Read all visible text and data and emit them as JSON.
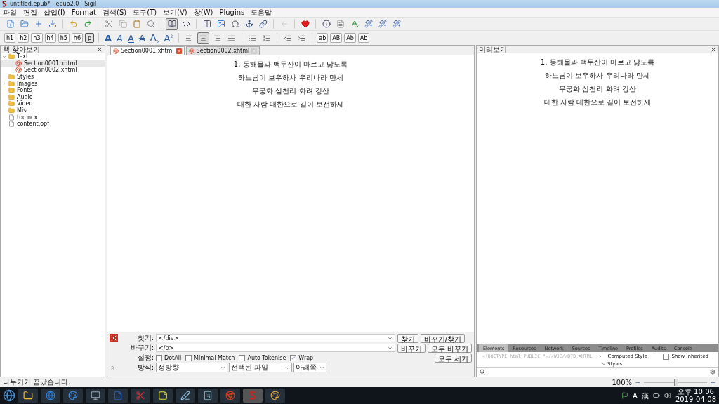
{
  "window": {
    "title": "untitled.epub* - epub2.0 - Sigil"
  },
  "menu": [
    "파일",
    "편집",
    "삽입(I)",
    "Format",
    "검색(S)",
    "도구(T)",
    "보기(V)",
    "창(W)",
    "Plugins",
    "도움말"
  ],
  "view_buttons": [
    {
      "selected": true
    },
    {
      "selected": false
    }
  ],
  "headings": [
    {
      "label": "h1",
      "selected": false
    },
    {
      "label": "h2",
      "selected": false
    },
    {
      "label": "h3",
      "selected": false
    },
    {
      "label": "h4",
      "selected": false
    },
    {
      "label": "h5",
      "selected": false
    },
    {
      "label": "h6",
      "selected": false
    },
    {
      "label": "p",
      "selected": true
    }
  ],
  "text_styles": [
    {
      "label": "A",
      "kind": "bold"
    },
    {
      "label": "A",
      "kind": "italic"
    },
    {
      "label": "A",
      "kind": "underline"
    },
    {
      "label": "A",
      "kind": "strike"
    },
    {
      "label": "A$_{2}$",
      "kind": "plain"
    },
    {
      "label": "A$^{2}$",
      "kind": "plain"
    }
  ],
  "align_buttons": [
    {
      "selected": false
    },
    {
      "selected": true
    },
    {
      "selected": false
    },
    {
      "selected": false
    }
  ],
  "case_buttons": [
    "ab",
    "AB",
    "Ab",
    "Ab"
  ],
  "book_browser": {
    "title": "책 찾아보기",
    "items": [
      {
        "label": "Text",
        "kind": "folder",
        "expanded": true,
        "children": [
          {
            "label": "Section0001.xhtml",
            "kind": "html",
            "selected": true
          },
          {
            "label": "Section0002.xhtml",
            "kind": "html",
            "selected": false
          }
        ]
      },
      {
        "label": "Styles",
        "kind": "folder"
      },
      {
        "label": "Images",
        "kind": "folder",
        "expanded": false
      },
      {
        "label": "Fonts",
        "kind": "folder"
      },
      {
        "label": "Audio",
        "kind": "folder"
      },
      {
        "label": "Video",
        "kind": "folder"
      },
      {
        "label": "Misc",
        "kind": "folder"
      },
      {
        "label": "toc.ncx",
        "kind": "file"
      },
      {
        "label": "content.opf",
        "kind": "file"
      }
    ]
  },
  "tabs": [
    {
      "label": "Section0001.xhtml",
      "selected": true
    },
    {
      "label": "Section0002.xhtml",
      "selected": false
    }
  ],
  "editor_lines": [
    "1. 동해물과 백두산이 마르고 닳도록",
    "하느님이 보우하사 우리나라 만세",
    "무궁화 삼천리 화려 강산",
    "대한 사람 대한으로 길이 보전하세"
  ],
  "find_replace": {
    "find_label": "찾기:",
    "find_value": "</div>",
    "replace_label": "바꾸기:",
    "replace_value": "</p>",
    "options_label": "설정:",
    "options": [
      {
        "label": "DotAll",
        "checked": false
      },
      {
        "label": "Minimal Match",
        "checked": false
      },
      {
        "label": "Auto-Tokenise",
        "checked": false
      },
      {
        "label": "Wrap",
        "checked": true
      }
    ],
    "mode_label": "방식:",
    "dropdowns": [
      "정방향",
      "선택된 파일",
      "아래쪽"
    ],
    "buttons": [
      "찾기",
      "바꾸기/찾기",
      "바꾸기",
      "모두 바꾸기",
      "모두 세기"
    ]
  },
  "preview": {
    "title": "미리보기",
    "lines": [
      "1. 동해물과 백두산이 마르고 닳도록",
      "하느님이 보우하사 우리나라 만세",
      "무궁화 삼천리 화려 강산",
      "대한 사람 대한으로 길이 보전하세"
    ]
  },
  "devtools": {
    "tabs": [
      {
        "label": "Elements",
        "selected": true
      },
      {
        "label": "Resources",
        "selected": false
      },
      {
        "label": "Network",
        "selected": false
      },
      {
        "label": "Sources",
        "selected": false
      },
      {
        "label": "Timeline",
        "selected": false
      },
      {
        "label": "Profiles",
        "selected": false
      },
      {
        "label": "Audits",
        "selected": false
      },
      {
        "label": "Console",
        "selected": false
      }
    ],
    "source": "<!DOCTYPE html PUBLIC \"-//W3C//DTD XHTML",
    "computed_style": "Computed Style",
    "show_inherited": {
      "label": "Show inherited",
      "checked": false
    },
    "styles": "Styles"
  },
  "status_bar": {
    "message": "나누기가 끝났습니다.",
    "zoom": "100%",
    "zoom_slider": {
      "level": 0.5
    }
  },
  "taskbar": {
    "tray": [
      "A",
      "漢"
    ],
    "time": "오후 10:06",
    "date": "2019-04-08"
  }
}
